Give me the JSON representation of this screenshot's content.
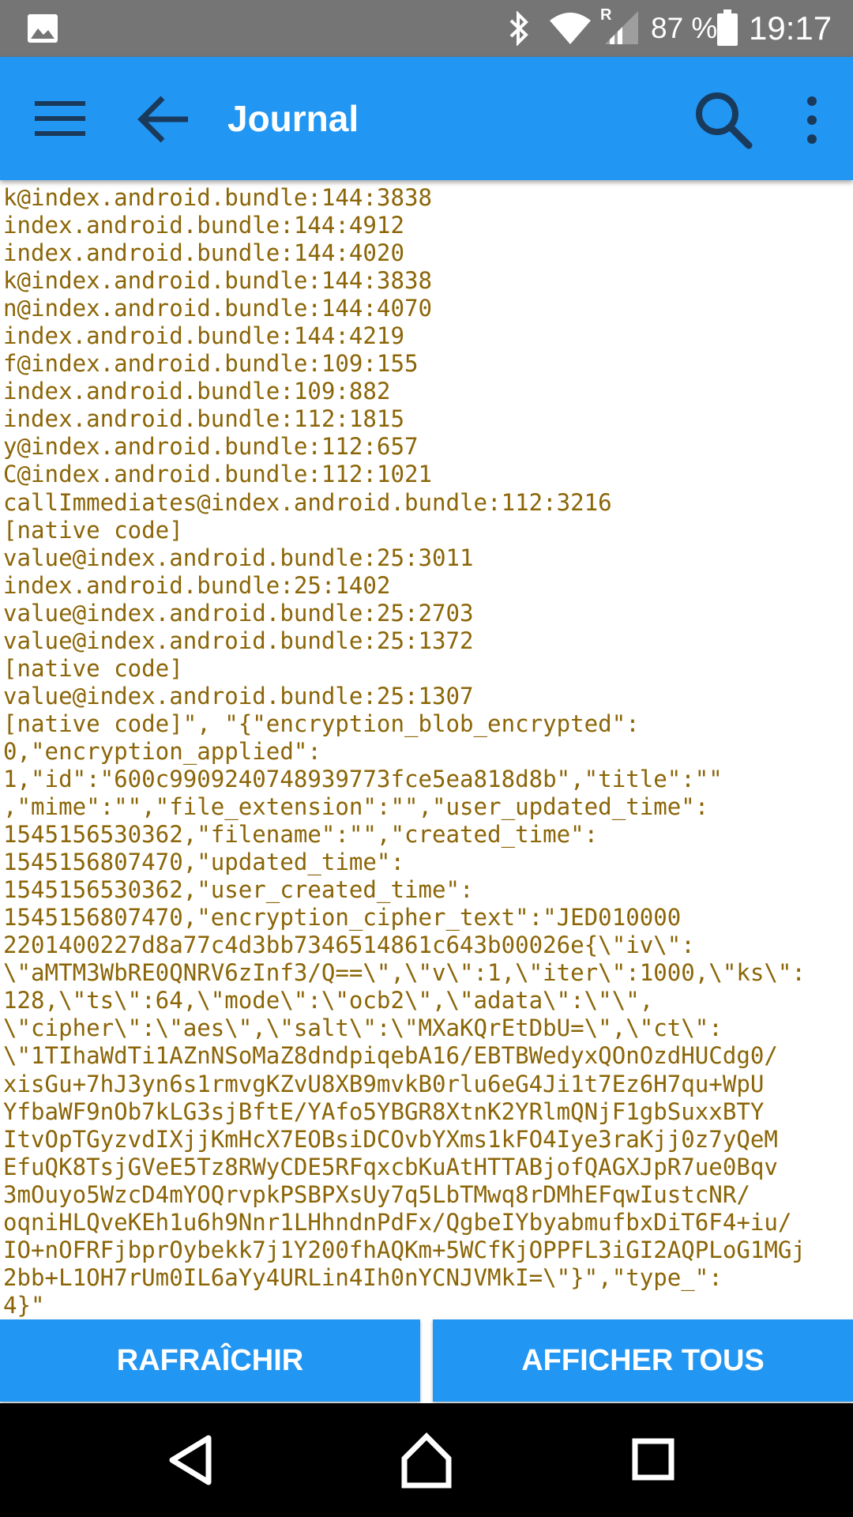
{
  "status_bar": {
    "network_roaming": "R",
    "battery": "87 %",
    "time": "19:17"
  },
  "app_bar": {
    "title": "Journal"
  },
  "log": {
    "lines": [
      "k@index.android.bundle:144:3838",
      "index.android.bundle:144:4912",
      "index.android.bundle:144:4020",
      "k@index.android.bundle:144:3838",
      "n@index.android.bundle:144:4070",
      "index.android.bundle:144:4219",
      "f@index.android.bundle:109:155",
      "index.android.bundle:109:882",
      "index.android.bundle:112:1815",
      "y@index.android.bundle:112:657",
      "C@index.android.bundle:112:1021",
      "callImmediates@index.android.bundle:112:3216",
      "[native code]",
      "value@index.android.bundle:25:3011",
      "index.android.bundle:25:1402",
      "value@index.android.bundle:25:2703",
      "value@index.android.bundle:25:1372",
      "[native code]",
      "value@index.android.bundle:25:1307",
      "[native code]\", \"{\"encryption_blob_encrypted\":",
      "0,\"encryption_applied\":",
      "1,\"id\":\"600c9909240748939773fce5ea818d8b\",\"title\":\"\"",
      ",\"mime\":\"\",\"file_extension\":\"\",\"user_updated_time\":",
      "1545156530362,\"filename\":\"\",\"created_time\":",
      "1545156807470,\"updated_time\":",
      "1545156530362,\"user_created_time\":",
      "1545156807470,\"encryption_cipher_text\":\"JED010000",
      "2201400227d8a77c4d3bb7346514861c643b00026e{\\\"iv\\\":",
      "\\\"aMTM3WbRE0QNRV6zInf3/Q==\\\",\\\"v\\\":1,\\\"iter\\\":1000,\\\"ks\\\":",
      "128,\\\"ts\\\":64,\\\"mode\\\":\\\"ocb2\\\",\\\"adata\\\":\\\"\\\",",
      "\\\"cipher\\\":\\\"aes\\\",\\\"salt\\\":\\\"MXaKQrEtDbU=\\\",\\\"ct\\\":",
      "\\\"1TIhaWdTi1AZnNSoMaZ8dndpiqebA16/EBTBWedyxQOnOzdHUCdg0/",
      "xisGu+7hJ3yn6s1rmvgKZvU8XB9mvkB0rlu6eG4Ji1t7Ez6H7qu+WpU",
      "YfbaWF9nOb7kLG3sjBftE/YAfo5YBGR8XtnK2YRlmQNjF1gbSuxxBTY",
      "ItvOpTGyzvdIXjjKmHcX7EOBsiDCOvbYXms1kFO4Iye3raKjj0z7yQeM",
      "EfuQK8TsjGVeE5Tz8RWyCDE5RFqxcbKuAtHTTABjofQAGXJpR7ue0Bqv",
      "3mOuyo5WzcD4mYOQrvpkPSBPXsUy7q5LbTMwq8rDMhEFqwIustcNR/",
      "oqniHLQveKEh1u6h9Nnr1LHhndnPdFx/QgbeIYbyabmufbxDiT6F4+iu/",
      "IO+nOFRFjbprOybekk7j1Y200fhAQKm+5WCfKjOPPFL3iGI2AQPLoG1MGj",
      "2bb+L1OH7rUm0IL6aYy4URLin4Ih0nYCNJVMkI=\\\"}\",\"type_\":",
      "4}\""
    ]
  },
  "buttons": {
    "refresh": "RAFRAÎCHIR",
    "show_all": "AFFICHER TOUS"
  }
}
